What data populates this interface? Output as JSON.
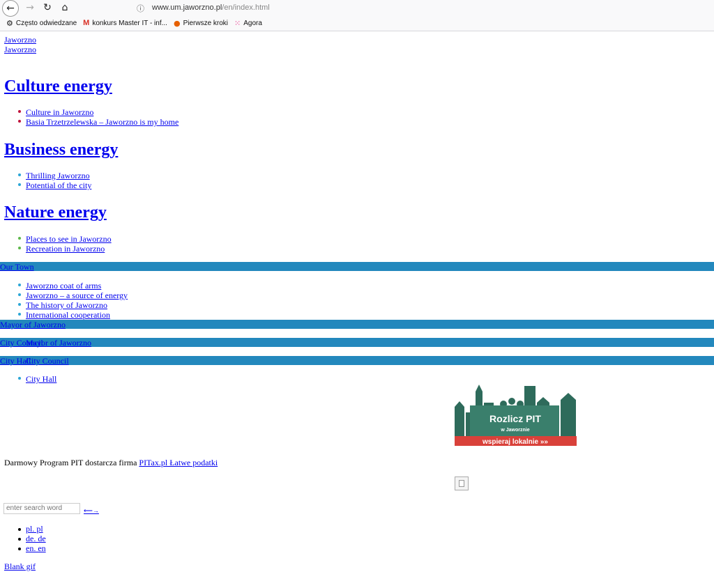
{
  "browser": {
    "url_host": "www.um.jaworzno.pl",
    "url_path": "/en/index.html",
    "bookmarks": [
      {
        "icon": "gear-icon",
        "label": "Często odwiedzane"
      },
      {
        "icon": "gmail-icon",
        "label": "konkurs Master IT - inf..."
      },
      {
        "icon": "firefox-icon",
        "label": "Pierwsze kroki"
      },
      {
        "icon": "agora-icon",
        "label": "Agora"
      }
    ]
  },
  "top_links": [
    "Jaworzno",
    "Jaworzno"
  ],
  "sections": [
    {
      "heading": "Culture energy",
      "bullet_color": "#c0143c",
      "items": [
        "Culture in Jaworzno",
        "Basia Trzetrzelewska – Jaworzno is my home"
      ]
    },
    {
      "heading": "Business energy",
      "bullet_color": "#2aa6d6",
      "items": [
        "Thrilling Jaworzno",
        "Potential of the city"
      ]
    },
    {
      "heading": "Nature energy",
      "bullet_color": "#5cb84a",
      "items": [
        "Places to see in Jaworzno",
        "Recreation in Jaworzno"
      ]
    }
  ],
  "menu": {
    "bar_color": "#2388bd",
    "our_town": "Our Town",
    "our_town_items": [
      "Jaworzno coat of arms",
      "Jaworzno – a source of energy",
      "The history of Jaworzno",
      "International cooperation"
    ],
    "mayor": "Mayor of Jaworzno",
    "city_council": "City Council",
    "mayor_overlap": "Mayor of Jaworzno",
    "city_hall": "City Hall",
    "city_council_overlap": "City Council",
    "city_hall_items": [
      "City Hall"
    ]
  },
  "logo": {
    "title": "Rozlicz PIT",
    "subtitle": "w Jaworznie",
    "tagline": "wspieraj lokalnie »»"
  },
  "footer": {
    "text": "Darmowy Program PIT dostarcza firma",
    "link": "PITax.pl Łatwe podatki"
  },
  "search": {
    "placeholder": "enter search word",
    "button": "⟵→"
  },
  "languages": [
    "pl. pl",
    "de. de",
    "en. en"
  ],
  "blank_link": "Blank gif"
}
